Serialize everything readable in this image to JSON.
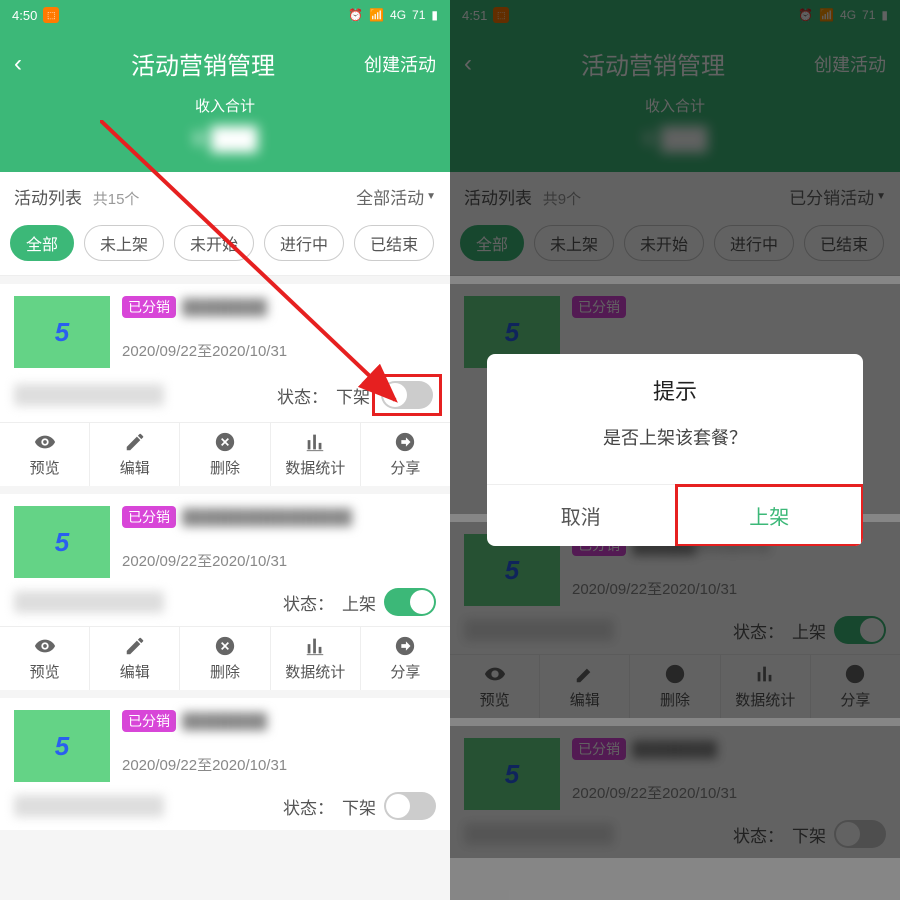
{
  "left": {
    "statusbar": {
      "time": "4:50",
      "network": "4G",
      "battery": "71"
    },
    "header": {
      "title": "活动营销管理",
      "create": "创建活动",
      "income_label": "收入合计",
      "income_amount": "¥ ███"
    },
    "list": {
      "label": "活动列表",
      "count": "共15个",
      "filter": "全部活动"
    },
    "pills": [
      "全部",
      "未上架",
      "未开始",
      "进行中",
      "已结束"
    ],
    "tag": "已分销",
    "date": "2020/09/22至2020/10/31",
    "state_label": "状态：",
    "state_off": "下架",
    "state_on": "上架",
    "thumb_num": "5",
    "actions": {
      "preview": "预览",
      "edit": "编辑",
      "delete": "删除",
      "stats": "数据统计",
      "share": "分享"
    }
  },
  "right": {
    "statusbar": {
      "time": "4:51",
      "network": "4G",
      "battery": "71"
    },
    "header": {
      "title": "活动营销管理",
      "create": "创建活动",
      "income_label": "收入合计",
      "income_amount": "¥ ███"
    },
    "list": {
      "label": "活动列表",
      "count": "共9个",
      "filter": "已分销活动"
    },
    "pills": [
      "全部",
      "未上架",
      "未开始",
      "进行中",
      "已结束"
    ],
    "dialog": {
      "title": "提示",
      "message": "是否上架该套餐？",
      "cancel": "取消",
      "ok": "上架"
    },
    "tag": "已分销",
    "date": "2020/09/22至2020/10/31",
    "state_label": "状态：",
    "state_on": "上架",
    "state_off": "下架",
    "thumb_num": "5",
    "actions": {
      "preview": "预览",
      "edit": "编辑",
      "delete": "删除",
      "stats": "数据统计",
      "share": "分享"
    }
  }
}
